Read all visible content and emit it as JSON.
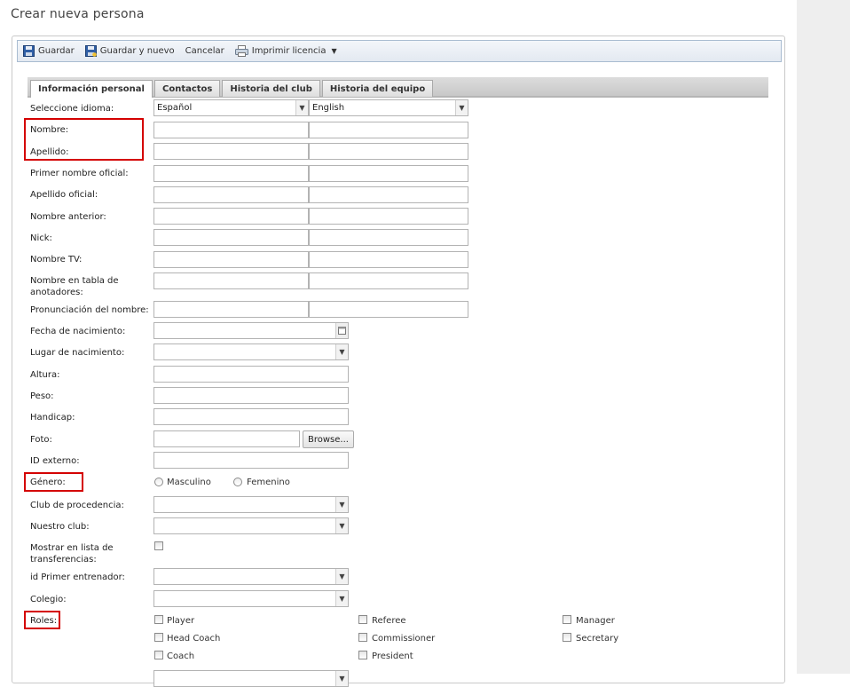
{
  "page": {
    "title": "Crear nueva persona"
  },
  "toolbar": {
    "save": "Guardar",
    "save_new": "Guardar y nuevo",
    "cancel": "Cancelar",
    "print": "Imprimir licencia"
  },
  "tabs": [
    "Información personal",
    "Contactos",
    "Historia del club",
    "Historia del equipo"
  ],
  "form": {
    "language": {
      "label": "Seleccione idioma:",
      "value1": "Español",
      "value2": "English"
    },
    "nombre": "Nombre:",
    "apellido": "Apellido:",
    "primer_nombre_oficial": "Primer nombre oficial:",
    "apellido_oficial": "Apellido oficial:",
    "nombre_anterior": "Nombre anterior:",
    "nick": "Nick:",
    "nombre_tv": "Nombre TV:",
    "nombre_tabla": "Nombre en tabla de anotadores:",
    "pronunciacion": "Pronunciación del nombre:",
    "fecha_nacimiento": "Fecha de nacimiento:",
    "lugar_nacimiento": "Lugar de nacimiento:",
    "altura": "Altura:",
    "peso": "Peso:",
    "handicap": "Handicap:",
    "foto": "Foto:",
    "browse": "Browse...",
    "id_externo": "ID externo:",
    "genero": {
      "label": "Género:",
      "male": "Masculino",
      "female": "Femenino"
    },
    "club_procedencia": "Club de procedencia:",
    "nuestro_club": "Nuestro club:",
    "mostrar_transferencias": "Mostrar en lista de transferencias:",
    "id_primer_entrenador": "id Primer entrenador:",
    "colegio": "Colegio:",
    "roles": {
      "label": "Roles:",
      "player": "Player",
      "head_coach": "Head Coach",
      "coach": "Coach",
      "referee": "Referee",
      "commissioner": "Commissioner",
      "president": "President",
      "manager": "Manager",
      "secretary": "Secretary"
    }
  },
  "colors": {
    "highlight": "#d40000",
    "toolbar_border": "#a9bcd1"
  }
}
